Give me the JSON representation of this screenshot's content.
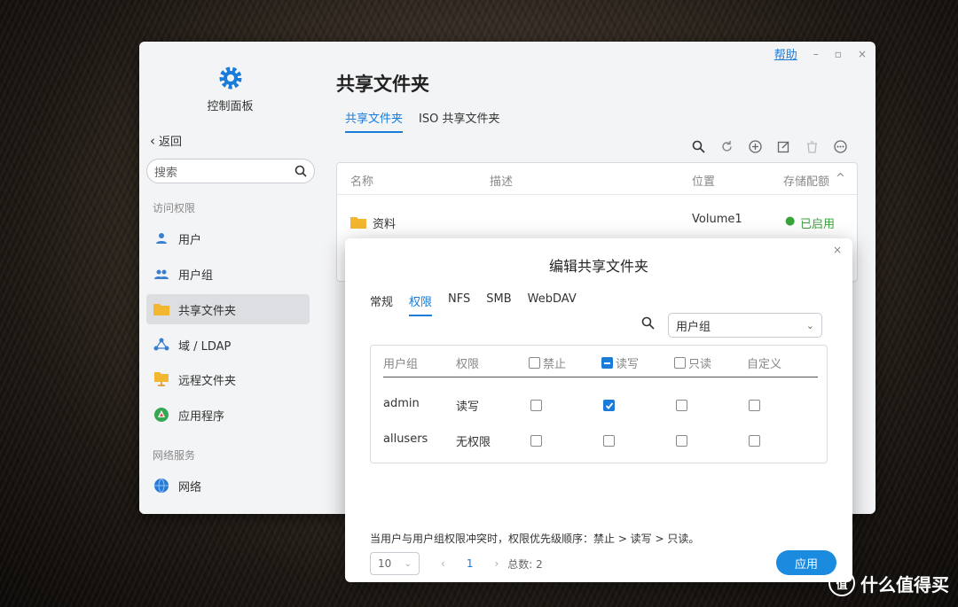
{
  "window": {
    "help": "帮助",
    "min": "–",
    "max": "▫",
    "close": "×",
    "sidebar": {
      "app_title": "控制面板",
      "back": "返回",
      "search_placeholder": "搜索",
      "section_access": "访问权限",
      "section_network": "网络服务",
      "items": [
        {
          "label": "用户",
          "icon": "user-icon"
        },
        {
          "label": "用户组",
          "icon": "group-icon"
        },
        {
          "label": "共享文件夹",
          "icon": "folder-icon"
        },
        {
          "label": "域 / LDAP",
          "icon": "ldap-icon"
        },
        {
          "label": "远程文件夹",
          "icon": "remote-folder-icon"
        },
        {
          "label": "应用程序",
          "icon": "app-icon"
        },
        {
          "label": "网络",
          "icon": "network-icon"
        }
      ]
    },
    "main": {
      "title": "共享文件夹",
      "tabs": [
        "共享文件夹",
        "ISO 共享文件夹"
      ],
      "table": {
        "headers": [
          "名称",
          "描述",
          "位置",
          "存储配额"
        ],
        "rows": [
          {
            "name": "资料",
            "location": "Volume1",
            "status": "已启用"
          }
        ]
      }
    }
  },
  "dialog": {
    "title": "编辑共享文件夹",
    "close": "×",
    "tabs": [
      "常规",
      "权限",
      "NFS",
      "SMB",
      "WebDAV"
    ],
    "filter": "用户组",
    "headers": {
      "group": "用户组",
      "perm": "权限",
      "deny": "禁止",
      "rw": "读写",
      "ro": "只读",
      "custom": "自定义"
    },
    "rows": [
      {
        "group": "admin",
        "perm": "读写",
        "deny": false,
        "rw": true,
        "ro": false,
        "custom": false
      },
      {
        "group": "allusers",
        "perm": "无权限",
        "deny": false,
        "rw": false,
        "ro": false,
        "custom": false
      }
    ],
    "note": "当用户与用户组权限冲突时，权限优先级顺序：禁止 > 读写 > 只读。",
    "page_size": "10",
    "page": "1",
    "total": "总数: 2",
    "apply": "应用"
  },
  "watermark": "什么值得买",
  "colors": {
    "accent": "#1b7bd8",
    "enabled": "#3aa33a",
    "folder": "#f2b630"
  }
}
